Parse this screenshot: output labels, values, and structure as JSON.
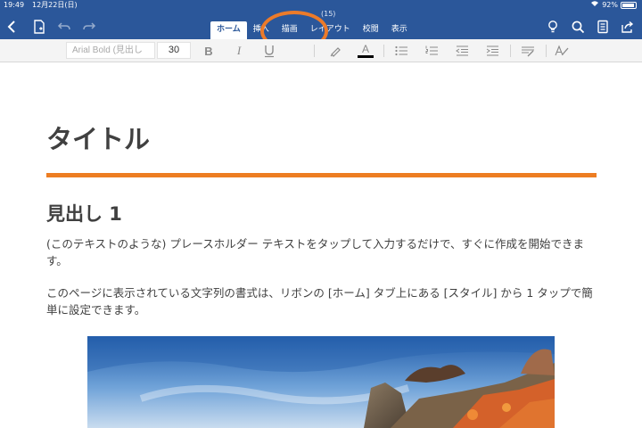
{
  "status_bar": {
    "time": "19:49",
    "date": "12月22日(日)",
    "battery": "92%"
  },
  "header": {
    "doc_title": "(15)"
  },
  "ribbon": {
    "tabs": [
      {
        "label": "ホーム",
        "active": true
      },
      {
        "label": "挿入",
        "active": false
      },
      {
        "label": "描画",
        "active": false
      },
      {
        "label": "レイアウト",
        "active": false
      },
      {
        "label": "校閲",
        "active": false
      },
      {
        "label": "表示",
        "active": false
      }
    ]
  },
  "toolbar": {
    "font_name": "Arial Bold (見出し",
    "font_size": "30",
    "bold_label": "B",
    "italic_label": "I",
    "font_color_label": "A",
    "font_color": "#000000",
    "icons": [
      "bold-icon",
      "italic-icon",
      "underline-icon",
      "highlighter-icon",
      "font-color-icon",
      "bullet-list-icon",
      "numbered-list-icon",
      "decrease-indent-icon",
      "increase-indent-icon",
      "paragraph-style-icon",
      "styles-icon"
    ]
  },
  "top_icons": [
    "back-icon",
    "file-icon",
    "undo-icon",
    "redo-icon",
    "lightbulb-icon",
    "search-icon",
    "document-icon",
    "share-icon"
  ],
  "document": {
    "title": "タイトル",
    "heading1": "見出し 1",
    "paragraph1": "(このテキストのような) プレースホルダー テキストをタップして入力するだけで、すぐに作成を開始できます。",
    "paragraph2": "このページに表示されている文字列の書式は、リボンの [ホーム] タブ上にある [スタイル] から 1 タップで簡単に設定できます。"
  },
  "colors": {
    "ribbon_blue": "#2b579a",
    "accent_orange": "#ed7d22",
    "annotation_orange": "#ec7b2a"
  }
}
